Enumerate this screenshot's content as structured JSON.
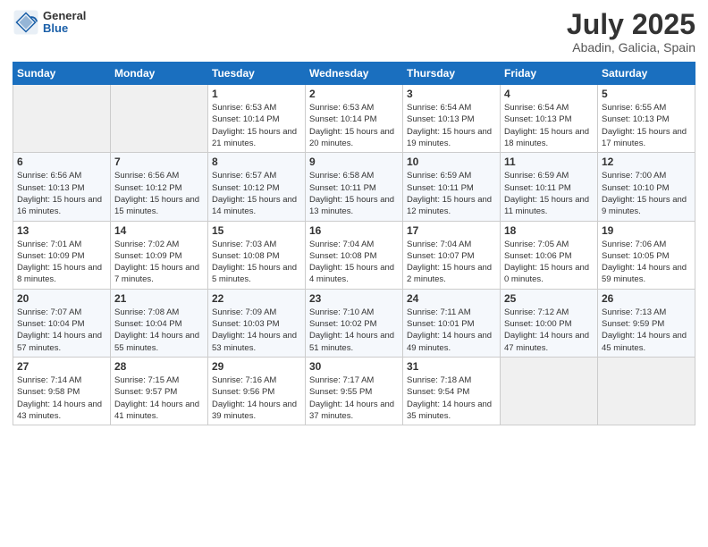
{
  "header": {
    "logo_general": "General",
    "logo_blue": "Blue",
    "title": "July 2025",
    "location": "Abadin, Galicia, Spain"
  },
  "days_of_week": [
    "Sunday",
    "Monday",
    "Tuesday",
    "Wednesday",
    "Thursday",
    "Friday",
    "Saturday"
  ],
  "weeks": [
    [
      {
        "day": "",
        "info": ""
      },
      {
        "day": "",
        "info": ""
      },
      {
        "day": "1",
        "info": "Sunrise: 6:53 AM\nSunset: 10:14 PM\nDaylight: 15 hours and 21 minutes."
      },
      {
        "day": "2",
        "info": "Sunrise: 6:53 AM\nSunset: 10:14 PM\nDaylight: 15 hours and 20 minutes."
      },
      {
        "day": "3",
        "info": "Sunrise: 6:54 AM\nSunset: 10:13 PM\nDaylight: 15 hours and 19 minutes."
      },
      {
        "day": "4",
        "info": "Sunrise: 6:54 AM\nSunset: 10:13 PM\nDaylight: 15 hours and 18 minutes."
      },
      {
        "day": "5",
        "info": "Sunrise: 6:55 AM\nSunset: 10:13 PM\nDaylight: 15 hours and 17 minutes."
      }
    ],
    [
      {
        "day": "6",
        "info": "Sunrise: 6:56 AM\nSunset: 10:13 PM\nDaylight: 15 hours and 16 minutes."
      },
      {
        "day": "7",
        "info": "Sunrise: 6:56 AM\nSunset: 10:12 PM\nDaylight: 15 hours and 15 minutes."
      },
      {
        "day": "8",
        "info": "Sunrise: 6:57 AM\nSunset: 10:12 PM\nDaylight: 15 hours and 14 minutes."
      },
      {
        "day": "9",
        "info": "Sunrise: 6:58 AM\nSunset: 10:11 PM\nDaylight: 15 hours and 13 minutes."
      },
      {
        "day": "10",
        "info": "Sunrise: 6:59 AM\nSunset: 10:11 PM\nDaylight: 15 hours and 12 minutes."
      },
      {
        "day": "11",
        "info": "Sunrise: 6:59 AM\nSunset: 10:11 PM\nDaylight: 15 hours and 11 minutes."
      },
      {
        "day": "12",
        "info": "Sunrise: 7:00 AM\nSunset: 10:10 PM\nDaylight: 15 hours and 9 minutes."
      }
    ],
    [
      {
        "day": "13",
        "info": "Sunrise: 7:01 AM\nSunset: 10:09 PM\nDaylight: 15 hours and 8 minutes."
      },
      {
        "day": "14",
        "info": "Sunrise: 7:02 AM\nSunset: 10:09 PM\nDaylight: 15 hours and 7 minutes."
      },
      {
        "day": "15",
        "info": "Sunrise: 7:03 AM\nSunset: 10:08 PM\nDaylight: 15 hours and 5 minutes."
      },
      {
        "day": "16",
        "info": "Sunrise: 7:04 AM\nSunset: 10:08 PM\nDaylight: 15 hours and 4 minutes."
      },
      {
        "day": "17",
        "info": "Sunrise: 7:04 AM\nSunset: 10:07 PM\nDaylight: 15 hours and 2 minutes."
      },
      {
        "day": "18",
        "info": "Sunrise: 7:05 AM\nSunset: 10:06 PM\nDaylight: 15 hours and 0 minutes."
      },
      {
        "day": "19",
        "info": "Sunrise: 7:06 AM\nSunset: 10:05 PM\nDaylight: 14 hours and 59 minutes."
      }
    ],
    [
      {
        "day": "20",
        "info": "Sunrise: 7:07 AM\nSunset: 10:04 PM\nDaylight: 14 hours and 57 minutes."
      },
      {
        "day": "21",
        "info": "Sunrise: 7:08 AM\nSunset: 10:04 PM\nDaylight: 14 hours and 55 minutes."
      },
      {
        "day": "22",
        "info": "Sunrise: 7:09 AM\nSunset: 10:03 PM\nDaylight: 14 hours and 53 minutes."
      },
      {
        "day": "23",
        "info": "Sunrise: 7:10 AM\nSunset: 10:02 PM\nDaylight: 14 hours and 51 minutes."
      },
      {
        "day": "24",
        "info": "Sunrise: 7:11 AM\nSunset: 10:01 PM\nDaylight: 14 hours and 49 minutes."
      },
      {
        "day": "25",
        "info": "Sunrise: 7:12 AM\nSunset: 10:00 PM\nDaylight: 14 hours and 47 minutes."
      },
      {
        "day": "26",
        "info": "Sunrise: 7:13 AM\nSunset: 9:59 PM\nDaylight: 14 hours and 45 minutes."
      }
    ],
    [
      {
        "day": "27",
        "info": "Sunrise: 7:14 AM\nSunset: 9:58 PM\nDaylight: 14 hours and 43 minutes."
      },
      {
        "day": "28",
        "info": "Sunrise: 7:15 AM\nSunset: 9:57 PM\nDaylight: 14 hours and 41 minutes."
      },
      {
        "day": "29",
        "info": "Sunrise: 7:16 AM\nSunset: 9:56 PM\nDaylight: 14 hours and 39 minutes."
      },
      {
        "day": "30",
        "info": "Sunrise: 7:17 AM\nSunset: 9:55 PM\nDaylight: 14 hours and 37 minutes."
      },
      {
        "day": "31",
        "info": "Sunrise: 7:18 AM\nSunset: 9:54 PM\nDaylight: 14 hours and 35 minutes."
      },
      {
        "day": "",
        "info": ""
      },
      {
        "day": "",
        "info": ""
      }
    ]
  ]
}
